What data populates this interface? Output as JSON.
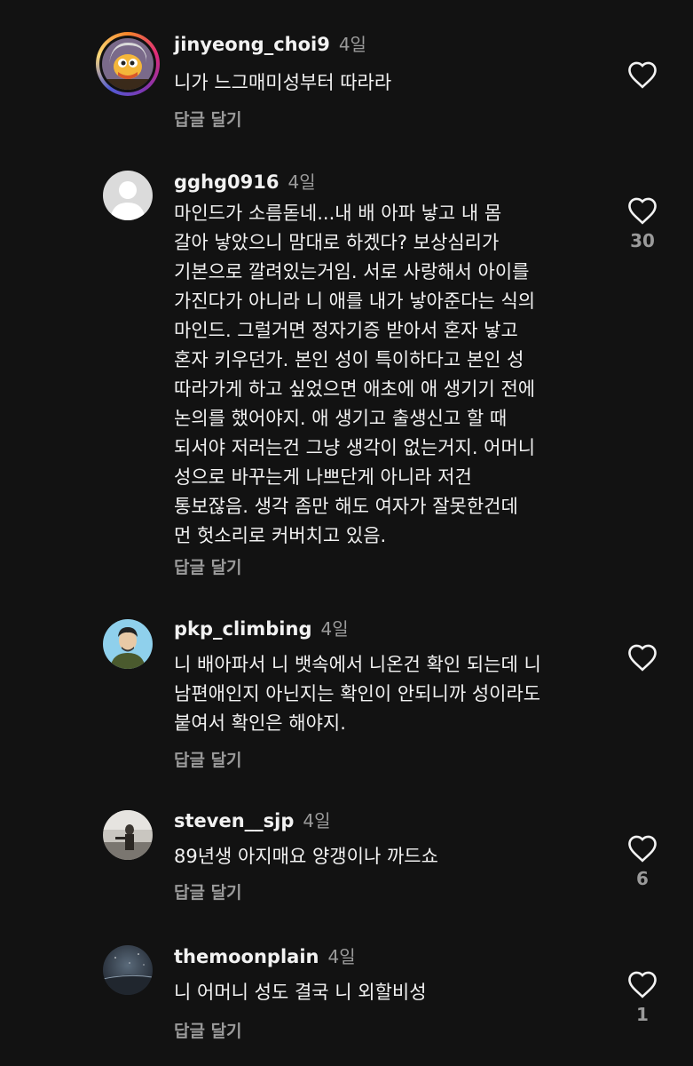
{
  "comments": [
    {
      "username": "jinyeong_choi9",
      "time": "4일",
      "text": "니가 느그매미성부터 따라라",
      "reply_label": "답글 달기",
      "likes": ""
    },
    {
      "username": "gghg0916",
      "time": "4일",
      "text": "마인드가 소름돋네...내 배 아파 낳고 내 몸\n갈아 낳았으니 맘대로 하겠다? 보상심리가\n기본으로 깔려있는거임. 서로 사랑해서 아이를\n가진다가 아니라 니 애를 내가 낳아준다는 식의\n마인드. 그럴거면 정자기증 받아서 혼자 낳고\n혼자 키우던가. 본인 성이 특이하다고 본인 성\n따라가게 하고 싶었으면 애초에 애 생기기 전에\n논의를 했어야지. 애 생기고 출생신고 할 때\n되서야 저러는건 그냥 생각이 없는거지. 어머니\n성으로 바꾸는게 나쁘단게 아니라 저건\n통보잖음. 생각 좀만 해도 여자가 잘못한건데\n먼 헛소리로 커버치고 있음.",
      "reply_label": "답글 달기",
      "likes": "30"
    },
    {
      "username": "pkp_climbing",
      "time": "4일",
      "text": "니 배아파서 니 뱃속에서 니온건 확인 되는데 니\n남편애인지 아닌지는 확인이 안되니까 성이라도\n붙여서 확인은 해야지.",
      "reply_label": "답글 달기",
      "likes": ""
    },
    {
      "username": "steven__sjp",
      "time": "4일",
      "text": "89년생 아지매요 양갱이나 까드쇼",
      "reply_label": "답글 달기",
      "likes": "6"
    },
    {
      "username": "themoonplain",
      "time": "4일",
      "text": "니 어머니 성도 결국 니 외할비성",
      "reply_label": "답글 달기",
      "likes": "1"
    }
  ],
  "icons": {
    "like": "heart-outline-icon",
    "avatar_default": "default-avatar-icon"
  },
  "colors": {
    "background": "#121212",
    "text": "#f2f2f2",
    "muted": "#9a9a9a"
  }
}
